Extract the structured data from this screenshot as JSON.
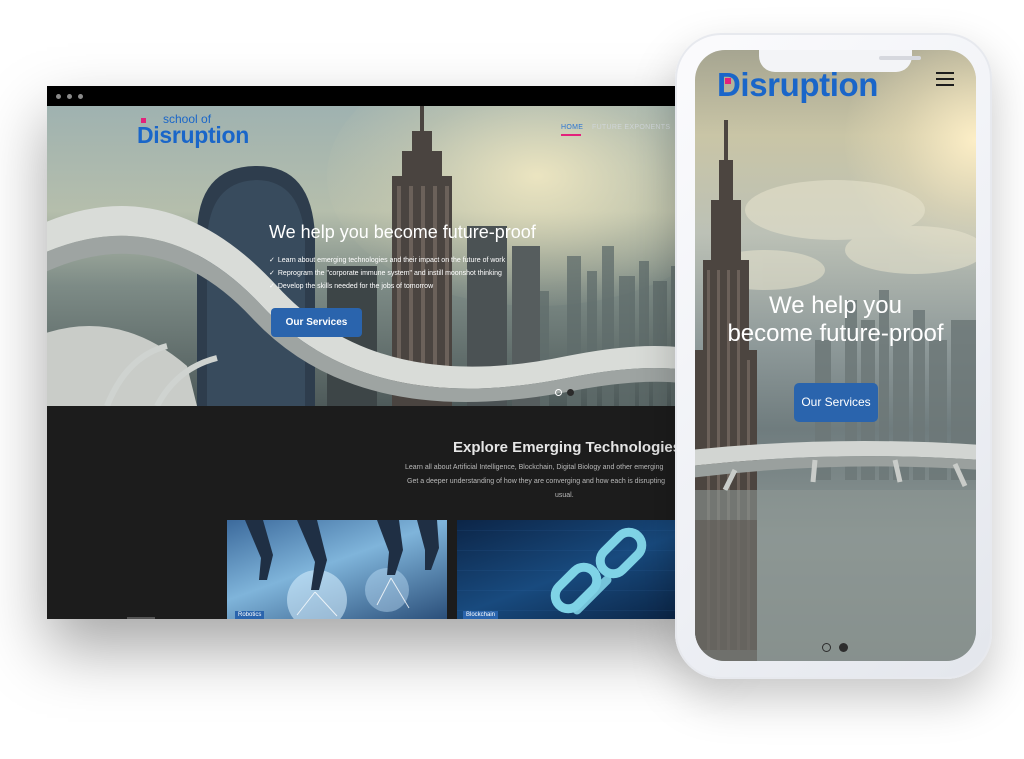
{
  "desktop": {
    "logo": {
      "top_text": "school of",
      "main_text": "Disruption"
    },
    "nav": {
      "home": "HOME",
      "second": "FUTURE EXPONENTS"
    },
    "hero": {
      "title": "We help you become future-proof",
      "bullets": [
        "Learn about emerging technologies and their impact on the future of work",
        "Reprogram the \"corporate immune system\" and instill moonshot thinking",
        "Develop the skills needed for the jobs of tomorrow"
      ],
      "check": "✓",
      "button": "Our Services"
    },
    "explore": {
      "title": "Explore Emerging Technologies",
      "line1": "Learn all about Artificial Intelligence, Blockchain, Digital Biology and other emerging",
      "line2": "Get a deeper understanding of how they are converging and how each is disrupting",
      "line3": "usual."
    },
    "tiles": [
      {
        "label": "Robotics"
      },
      {
        "label": "Blockchain"
      }
    ]
  },
  "phone": {
    "logo": {
      "main_text": "Disruption"
    },
    "hero": {
      "title_line1": "We help you",
      "title_line2": "become future-proof",
      "button": "Our Services"
    }
  },
  "colors": {
    "brand_blue": "#1a66c9",
    "button_blue": "#2a64ad",
    "accent_pink": "#e3217b"
  }
}
